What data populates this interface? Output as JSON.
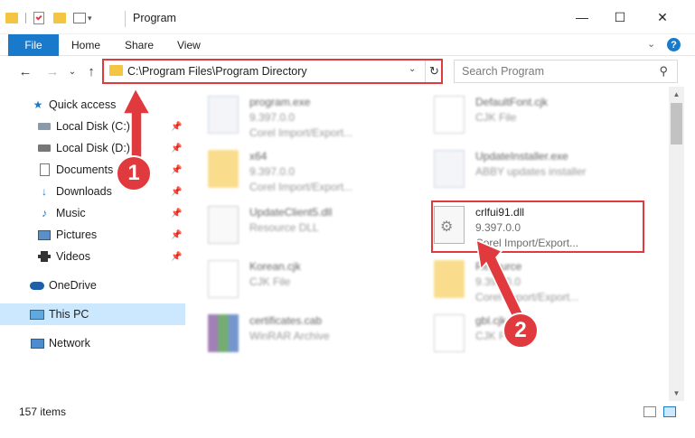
{
  "window": {
    "title": "Program",
    "minimize_glyph": "—",
    "maximize_glyph": "☐",
    "close_glyph": "✕"
  },
  "ribbon": {
    "tabs": [
      "File",
      "Home",
      "Share",
      "View"
    ],
    "help_glyph": "?",
    "collapse_glyph": "⌄"
  },
  "nav": {
    "back_glyph": "←",
    "forward_glyph": "→",
    "recent_glyph": "⌄",
    "up_glyph": "↑",
    "address": "C:\\Program Files\\Program Directory",
    "address_dropdown_glyph": "⌄",
    "refresh_glyph": "↻",
    "search_placeholder": "Search Program",
    "search_glyph": "⚲"
  },
  "sidebar": {
    "items": [
      {
        "label": "Quick access",
        "icon": "star-icon",
        "pinned": false
      },
      {
        "label": "Local Disk (C:)",
        "icon": "drive-icon",
        "pinned": true
      },
      {
        "label": "Local Disk (D:)",
        "icon": "drive-icon",
        "pinned": true
      },
      {
        "label": "Documents",
        "icon": "documents-icon",
        "pinned": true
      },
      {
        "label": "Downloads",
        "icon": "downloads-icon",
        "pinned": true
      },
      {
        "label": "Music",
        "icon": "music-icon",
        "pinned": true
      },
      {
        "label": "Pictures",
        "icon": "pictures-icon",
        "pinned": true
      },
      {
        "label": "Videos",
        "icon": "videos-icon",
        "pinned": true
      },
      {
        "label": "OneDrive",
        "icon": "cloud-icon",
        "pinned": false
      },
      {
        "label": "This PC",
        "icon": "computer-icon",
        "pinned": false,
        "selected": true
      },
      {
        "label": "Network",
        "icon": "network-icon",
        "pinned": false
      }
    ]
  },
  "files": [
    {
      "name": "program.exe",
      "line1": "9.397.0.0",
      "line2": "Corel Import/Export...",
      "type": "exe",
      "highlighted": false
    },
    {
      "name": "DefaultFont.cjk",
      "line1": "CJK File",
      "line2": "",
      "type": "doc",
      "highlighted": false
    },
    {
      "name": "x64",
      "line1": "9.397.0.0",
      "line2": "Corel Import/Export...",
      "type": "folder",
      "highlighted": false
    },
    {
      "name": "UpdateInstaller.exe",
      "line1": "ABBY updates installer",
      "line2": "",
      "type": "exe",
      "highlighted": false
    },
    {
      "name": "UpdateClient5.dll",
      "line1": "Resource DLL",
      "line2": "",
      "type": "dll",
      "highlighted": false
    },
    {
      "name": "crlfui91.dll",
      "line1": "9.397.0.0",
      "line2": "Corel Import/Export...",
      "type": "dll",
      "highlighted": true
    },
    {
      "name": "Korean.cjk",
      "line1": "CJK File",
      "line2": "",
      "type": "doc",
      "highlighted": false
    },
    {
      "name": "Resource",
      "line1": "9.397.0.0",
      "line2": "Corel Import/Export...",
      "type": "folder",
      "highlighted": false
    },
    {
      "name": "certificates.cab",
      "line1": "WinRAR Archive",
      "line2": "",
      "type": "cab",
      "highlighted": false
    },
    {
      "name": "gbl.cjk",
      "line1": "CJK File",
      "line2": "",
      "type": "doc",
      "highlighted": false
    }
  ],
  "status": {
    "items_count": "157 items"
  },
  "annotations": {
    "step1": "1",
    "step2": "2",
    "accent_color": "#e0393e"
  },
  "colors": {
    "file_tab": "#1979ca",
    "selected_nav": "#cce8ff"
  }
}
